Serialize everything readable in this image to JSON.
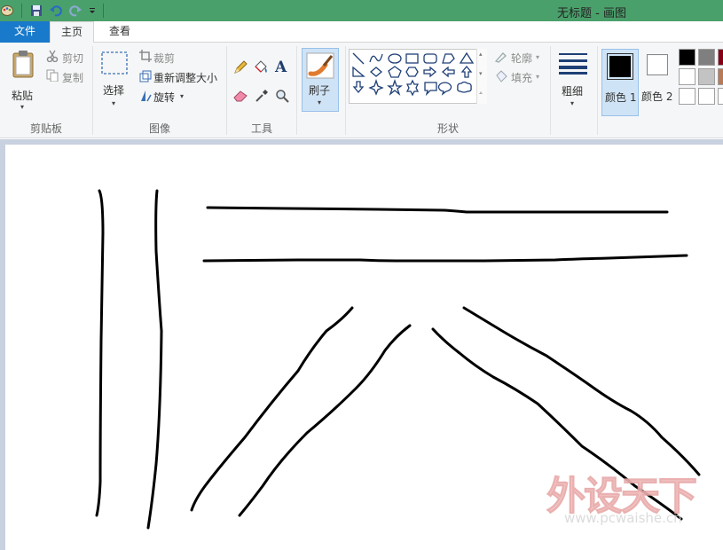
{
  "window": {
    "title": "无标题 - 画图"
  },
  "tabs": {
    "file": "文件",
    "home": "主页",
    "view": "查看"
  },
  "clipboard": {
    "paste": "粘贴",
    "cut": "剪切",
    "copy": "复制",
    "group_label": "剪贴板"
  },
  "image": {
    "select": "选择",
    "crop": "裁剪",
    "resize": "重新调整大小",
    "rotate": "旋转",
    "group_label": "图像"
  },
  "tools": {
    "group_label": "工具",
    "text_tool_glyph": "A"
  },
  "brushes": {
    "label": "刷子"
  },
  "shapes": {
    "outline": "轮廓",
    "fill": "填充",
    "group_label": "形状",
    "items": [
      "line",
      "curve",
      "oval",
      "rectangle",
      "rounded-rectangle",
      "polygon",
      "triangle",
      "right-triangle",
      "diamond",
      "pentagon",
      "hexagon",
      "right-arrow",
      "left-arrow",
      "up-arrow",
      "down-arrow",
      "four-point-star",
      "five-point-star",
      "six-point-star",
      "rounded-callout",
      "oval-callout",
      "cloud-callout"
    ]
  },
  "size": {
    "label": "粗细"
  },
  "colors": {
    "color1_label": "颜色 1",
    "color2_label": "颜色 2",
    "color1_value": "#000000",
    "color2_value": "#ffffff",
    "palette": [
      "#000000",
      "#7f7f7f",
      "#880015",
      "#ffffff",
      "#c3c3c3",
      "#b97a57",
      "#ffffff",
      "#ffffff",
      "#ffffff"
    ]
  },
  "watermark": {
    "text": "外设天下",
    "url": "www.pcwaishe.cn"
  },
  "theme": {
    "titlebar_bg": "#4aa06b",
    "file_tab_bg": "#1979ca",
    "ribbon_bg": "#f5f6f7",
    "workspace_bg": "#c7d1df"
  }
}
